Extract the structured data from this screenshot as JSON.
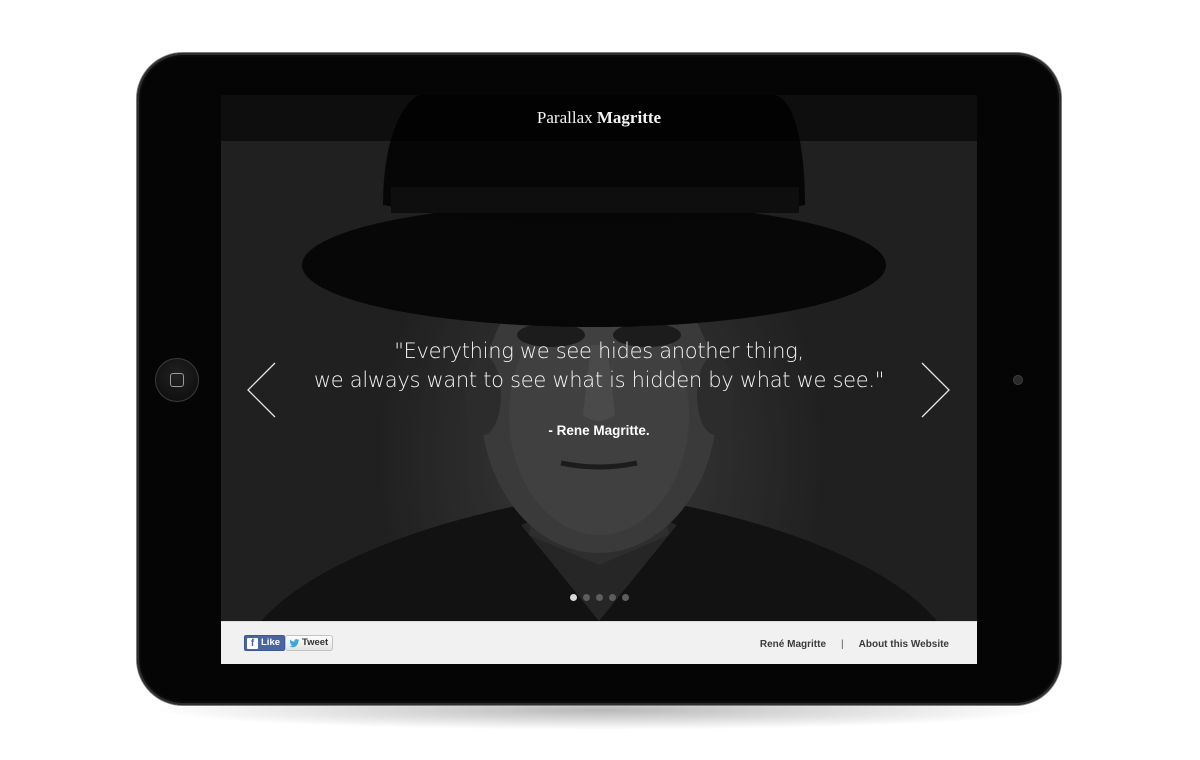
{
  "header": {
    "title_light": "Parallax",
    "title_bold": "Magritte"
  },
  "slide": {
    "quote_lines": [
      "\"Everything we see hides another thing,",
      "we always want to see what is hidden by what we see.\""
    ],
    "author": "- Rene Magritte."
  },
  "carousel": {
    "count": 5,
    "active_index": 0
  },
  "footer": {
    "like_label": "Like",
    "tweet_label": "Tweet",
    "nav": {
      "link1": "René Magritte",
      "separator": "|",
      "link2": "About this Website"
    }
  },
  "icons": {
    "prev": "chevron-left-icon",
    "next": "chevron-right-icon",
    "facebook": "facebook-icon",
    "twitter": "twitter-bird-icon",
    "home": "home-button-square-icon",
    "camera": "camera-dot"
  },
  "colors": {
    "device": "#050505",
    "topbar": "#0b0b0b",
    "footer_bg": "#f1f1f1",
    "facebook_blue": "#4a66a0",
    "dot_active": "#d9d9d9",
    "dot_inactive": "#5e5e5e"
  }
}
